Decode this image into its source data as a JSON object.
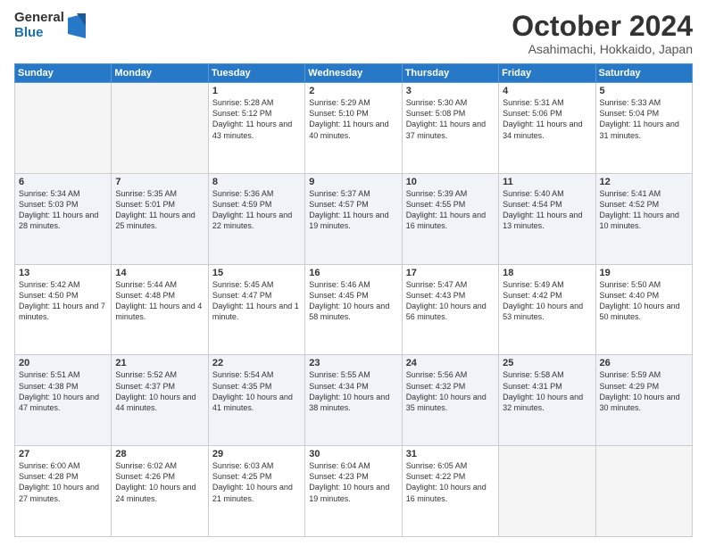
{
  "logo": {
    "general": "General",
    "blue": "Blue"
  },
  "title": "October 2024",
  "subtitle": "Asahimachi, Hokkaido, Japan",
  "weekdays": [
    "Sunday",
    "Monday",
    "Tuesday",
    "Wednesday",
    "Thursday",
    "Friday",
    "Saturday"
  ],
  "weeks": [
    [
      {
        "day": "",
        "sunrise": "",
        "sunset": "",
        "daylight": ""
      },
      {
        "day": "",
        "sunrise": "",
        "sunset": "",
        "daylight": ""
      },
      {
        "day": "1",
        "sunrise": "Sunrise: 5:28 AM",
        "sunset": "Sunset: 5:12 PM",
        "daylight": "Daylight: 11 hours and 43 minutes."
      },
      {
        "day": "2",
        "sunrise": "Sunrise: 5:29 AM",
        "sunset": "Sunset: 5:10 PM",
        "daylight": "Daylight: 11 hours and 40 minutes."
      },
      {
        "day": "3",
        "sunrise": "Sunrise: 5:30 AM",
        "sunset": "Sunset: 5:08 PM",
        "daylight": "Daylight: 11 hours and 37 minutes."
      },
      {
        "day": "4",
        "sunrise": "Sunrise: 5:31 AM",
        "sunset": "Sunset: 5:06 PM",
        "daylight": "Daylight: 11 hours and 34 minutes."
      },
      {
        "day": "5",
        "sunrise": "Sunrise: 5:33 AM",
        "sunset": "Sunset: 5:04 PM",
        "daylight": "Daylight: 11 hours and 31 minutes."
      }
    ],
    [
      {
        "day": "6",
        "sunrise": "Sunrise: 5:34 AM",
        "sunset": "Sunset: 5:03 PM",
        "daylight": "Daylight: 11 hours and 28 minutes."
      },
      {
        "day": "7",
        "sunrise": "Sunrise: 5:35 AM",
        "sunset": "Sunset: 5:01 PM",
        "daylight": "Daylight: 11 hours and 25 minutes."
      },
      {
        "day": "8",
        "sunrise": "Sunrise: 5:36 AM",
        "sunset": "Sunset: 4:59 PM",
        "daylight": "Daylight: 11 hours and 22 minutes."
      },
      {
        "day": "9",
        "sunrise": "Sunrise: 5:37 AM",
        "sunset": "Sunset: 4:57 PM",
        "daylight": "Daylight: 11 hours and 19 minutes."
      },
      {
        "day": "10",
        "sunrise": "Sunrise: 5:39 AM",
        "sunset": "Sunset: 4:55 PM",
        "daylight": "Daylight: 11 hours and 16 minutes."
      },
      {
        "day": "11",
        "sunrise": "Sunrise: 5:40 AM",
        "sunset": "Sunset: 4:54 PM",
        "daylight": "Daylight: 11 hours and 13 minutes."
      },
      {
        "day": "12",
        "sunrise": "Sunrise: 5:41 AM",
        "sunset": "Sunset: 4:52 PM",
        "daylight": "Daylight: 11 hours and 10 minutes."
      }
    ],
    [
      {
        "day": "13",
        "sunrise": "Sunrise: 5:42 AM",
        "sunset": "Sunset: 4:50 PM",
        "daylight": "Daylight: 11 hours and 7 minutes."
      },
      {
        "day": "14",
        "sunrise": "Sunrise: 5:44 AM",
        "sunset": "Sunset: 4:48 PM",
        "daylight": "Daylight: 11 hours and 4 minutes."
      },
      {
        "day": "15",
        "sunrise": "Sunrise: 5:45 AM",
        "sunset": "Sunset: 4:47 PM",
        "daylight": "Daylight: 11 hours and 1 minute."
      },
      {
        "day": "16",
        "sunrise": "Sunrise: 5:46 AM",
        "sunset": "Sunset: 4:45 PM",
        "daylight": "Daylight: 10 hours and 58 minutes."
      },
      {
        "day": "17",
        "sunrise": "Sunrise: 5:47 AM",
        "sunset": "Sunset: 4:43 PM",
        "daylight": "Daylight: 10 hours and 56 minutes."
      },
      {
        "day": "18",
        "sunrise": "Sunrise: 5:49 AM",
        "sunset": "Sunset: 4:42 PM",
        "daylight": "Daylight: 10 hours and 53 minutes."
      },
      {
        "day": "19",
        "sunrise": "Sunrise: 5:50 AM",
        "sunset": "Sunset: 4:40 PM",
        "daylight": "Daylight: 10 hours and 50 minutes."
      }
    ],
    [
      {
        "day": "20",
        "sunrise": "Sunrise: 5:51 AM",
        "sunset": "Sunset: 4:38 PM",
        "daylight": "Daylight: 10 hours and 47 minutes."
      },
      {
        "day": "21",
        "sunrise": "Sunrise: 5:52 AM",
        "sunset": "Sunset: 4:37 PM",
        "daylight": "Daylight: 10 hours and 44 minutes."
      },
      {
        "day": "22",
        "sunrise": "Sunrise: 5:54 AM",
        "sunset": "Sunset: 4:35 PM",
        "daylight": "Daylight: 10 hours and 41 minutes."
      },
      {
        "day": "23",
        "sunrise": "Sunrise: 5:55 AM",
        "sunset": "Sunset: 4:34 PM",
        "daylight": "Daylight: 10 hours and 38 minutes."
      },
      {
        "day": "24",
        "sunrise": "Sunrise: 5:56 AM",
        "sunset": "Sunset: 4:32 PM",
        "daylight": "Daylight: 10 hours and 35 minutes."
      },
      {
        "day": "25",
        "sunrise": "Sunrise: 5:58 AM",
        "sunset": "Sunset: 4:31 PM",
        "daylight": "Daylight: 10 hours and 32 minutes."
      },
      {
        "day": "26",
        "sunrise": "Sunrise: 5:59 AM",
        "sunset": "Sunset: 4:29 PM",
        "daylight": "Daylight: 10 hours and 30 minutes."
      }
    ],
    [
      {
        "day": "27",
        "sunrise": "Sunrise: 6:00 AM",
        "sunset": "Sunset: 4:28 PM",
        "daylight": "Daylight: 10 hours and 27 minutes."
      },
      {
        "day": "28",
        "sunrise": "Sunrise: 6:02 AM",
        "sunset": "Sunset: 4:26 PM",
        "daylight": "Daylight: 10 hours and 24 minutes."
      },
      {
        "day": "29",
        "sunrise": "Sunrise: 6:03 AM",
        "sunset": "Sunset: 4:25 PM",
        "daylight": "Daylight: 10 hours and 21 minutes."
      },
      {
        "day": "30",
        "sunrise": "Sunrise: 6:04 AM",
        "sunset": "Sunset: 4:23 PM",
        "daylight": "Daylight: 10 hours and 19 minutes."
      },
      {
        "day": "31",
        "sunrise": "Sunrise: 6:05 AM",
        "sunset": "Sunset: 4:22 PM",
        "daylight": "Daylight: 10 hours and 16 minutes."
      },
      {
        "day": "",
        "sunrise": "",
        "sunset": "",
        "daylight": ""
      },
      {
        "day": "",
        "sunrise": "",
        "sunset": "",
        "daylight": ""
      }
    ]
  ]
}
